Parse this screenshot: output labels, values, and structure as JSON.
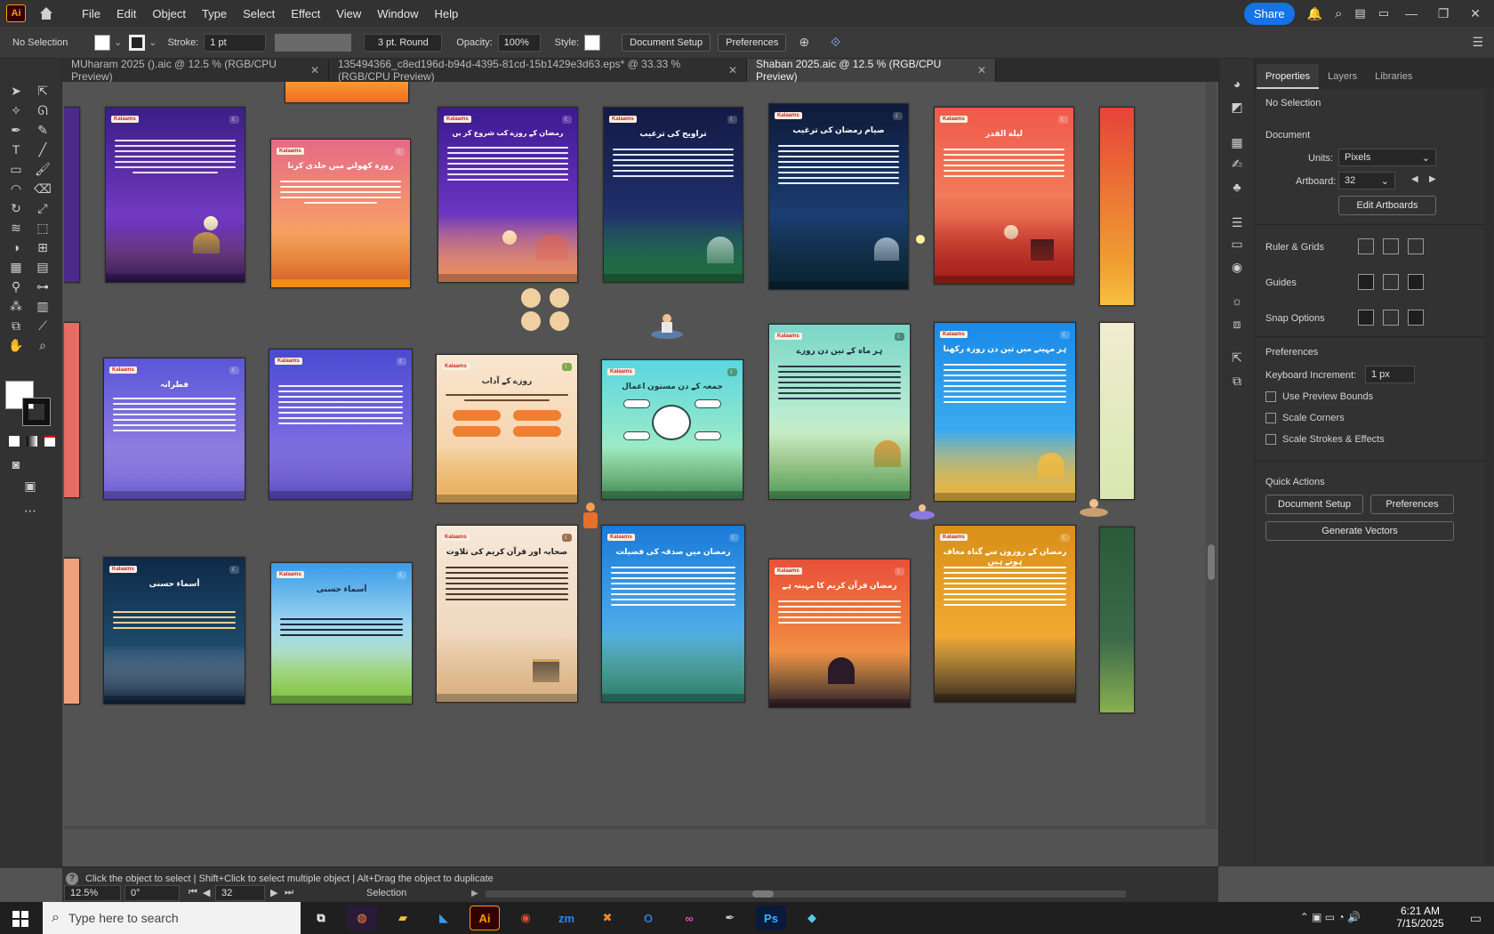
{
  "menubar": {
    "app_logo": "Ai",
    "menus": [
      "File",
      "Edit",
      "Object",
      "Type",
      "Select",
      "Effect",
      "View",
      "Window",
      "Help"
    ],
    "share_label": "Share"
  },
  "control_bar": {
    "selection_label": "No Selection",
    "stroke_label": "Stroke:",
    "stroke_value": "1 pt",
    "brush_value": "3 pt. Round",
    "opacity_label": "Opacity:",
    "opacity_value": "100%",
    "style_label": "Style:",
    "document_setup_label": "Document Setup",
    "preferences_label": "Preferences"
  },
  "tabs": [
    {
      "label": "MUharam 2025 ().aic @ 12.5 % (RGB/CPU Preview)",
      "active": false
    },
    {
      "label": "135494366_c8ed196d-b94d-4395-81cd-15b1429e3d63.eps* @ 33.33 % (RGB/CPU Preview)",
      "active": false
    },
    {
      "label": "Shaban 2025.aic @ 12.5 % (RGB/CPU Preview)",
      "active": true
    }
  ],
  "artboards": {
    "brand": "Kalaams",
    "titles": {
      "r1c4": "تراویح کی ترغیب",
      "r1c5": "صیام رمضان کی ترغیب",
      "r1c6": "لیلة القدر",
      "r1c3": "رمضان کے روزے کب شروع کر یں",
      "r1c2": "روزہ کھولنے میں جلدی کرنا",
      "r2c1": "فطرانہ",
      "r2c3": "روزے کے آداب",
      "r2c4": "جمعہ کے دن مسنون اعمال",
      "r2c5": "ہر ماہ کے تین دن روزے",
      "r2c6": "ہر مہینے میں تین دن روزہ رکھنا",
      "r3c1": "أسماء حسنی",
      "r3c2": "أسماء حسنی",
      "r3c3": "صحابہ اور قرآن کریم کی تلاوت",
      "r3c4": "رمضان میں صدقہ کی فضیلت",
      "r3c5": "رمضان قرآن کریم کا مہینہ ہے",
      "r3c6": "رمضان کے روزوں سے گناہ معاف ہوتے ہیں"
    }
  },
  "statusbar": {
    "hint": "Click the object to select  |  Shift+Click to select multiple object  |  Alt+Drag the object to duplicate",
    "zoom": "12.5%",
    "rotation": "0°",
    "artboard_number": "32",
    "mode": "Selection"
  },
  "panel": {
    "tabs": [
      "Properties",
      "Layers",
      "Libraries"
    ],
    "selection": "No Selection",
    "document_header": "Document",
    "units_label": "Units:",
    "units_value": "Pixels",
    "artboard_label": "Artboard:",
    "artboard_value": "32",
    "edit_artboards": "Edit Artboards",
    "rulers_grids": "Ruler & Grids",
    "guides": "Guides",
    "snap_options": "Snap Options",
    "preferences_header": "Preferences",
    "keyboard_increment_label": "Keyboard Increment:",
    "keyboard_increment_value": "1 px",
    "use_preview_bounds": "Use Preview Bounds",
    "scale_corners": "Scale Corners",
    "scale_strokes": "Scale Strokes & Effects",
    "quick_actions": "Quick Actions",
    "document_setup": "Document Setup",
    "preferences": "Preferences",
    "generate_vectors": "Generate Vectors"
  },
  "taskbar": {
    "search_placeholder": "Type here to search",
    "time": "6:21 AM",
    "date": "7/15/2025"
  }
}
